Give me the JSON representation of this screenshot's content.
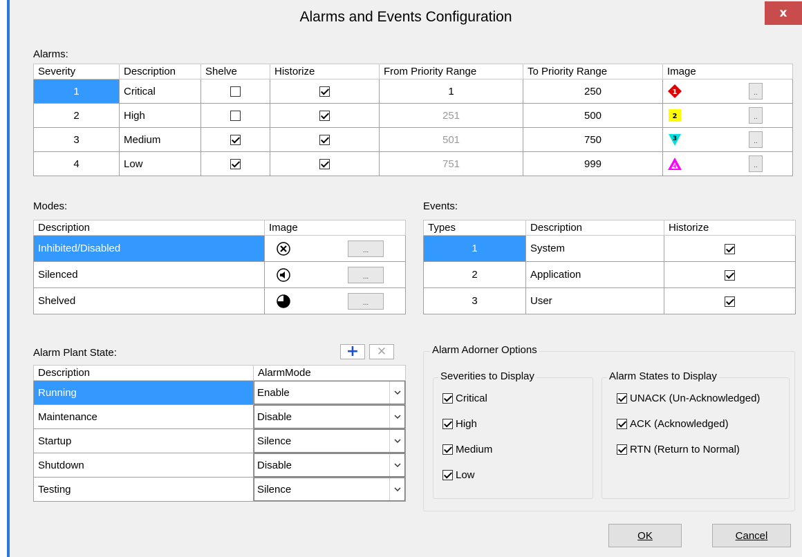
{
  "window": {
    "title": "Alarms and Events Configuration",
    "close_glyph": "x"
  },
  "alarms": {
    "label": "Alarms:",
    "columns": [
      "Severity",
      "Description",
      "Shelve",
      "Historize",
      "From Priority Range",
      "To Priority Range",
      "Image"
    ],
    "rows": [
      {
        "severity": "1",
        "description": "Critical",
        "shelve": false,
        "historize": true,
        "from": "1",
        "to": "250",
        "icon": "red-diamond-icon",
        "icon_text": "1",
        "icon_color": "#e00000"
      },
      {
        "severity": "2",
        "description": "High",
        "shelve": false,
        "historize": true,
        "from": "251",
        "to": "500",
        "icon": "yellow-square-icon",
        "icon_text": "2",
        "icon_color": "#ffff00"
      },
      {
        "severity": "3",
        "description": "Medium",
        "shelve": true,
        "historize": true,
        "from": "501",
        "to": "750",
        "icon": "cyan-triangle-icon",
        "icon_text": "3",
        "icon_color": "#00e0e0"
      },
      {
        "severity": "4",
        "description": "Low",
        "shelve": true,
        "historize": true,
        "from": "751",
        "to": "999",
        "icon": "magenta-triangle-icon",
        "icon_text": "4",
        "icon_color": "#ff00ff"
      }
    ],
    "ellipsis": ".."
  },
  "modes": {
    "label": "Modes:",
    "columns": [
      "Description",
      "Image"
    ],
    "rows": [
      {
        "description": "Inhibited/Disabled",
        "icon": "circle-x-icon"
      },
      {
        "description": "Silenced",
        "icon": "circle-speaker-icon"
      },
      {
        "description": "Shelved",
        "icon": "circle-pie-icon"
      }
    ],
    "ellipsis": "..."
  },
  "events": {
    "label": "Events:",
    "columns": [
      "Types",
      "Description",
      "Historize"
    ],
    "rows": [
      {
        "type": "1",
        "description": "System",
        "historize": true
      },
      {
        "type": "2",
        "description": "Application",
        "historize": true
      },
      {
        "type": "3",
        "description": "User",
        "historize": true
      }
    ]
  },
  "plant_state": {
    "label": "Alarm Plant State:",
    "add_icon": "plus-icon",
    "delete_icon": "delete-x-icon",
    "columns": [
      "Description",
      "AlarmMode"
    ],
    "rows": [
      {
        "description": "Running",
        "mode": "Enable"
      },
      {
        "description": "Maintenance",
        "mode": "Disable"
      },
      {
        "description": "Startup",
        "mode": "Silence"
      },
      {
        "description": "Shutdown",
        "mode": "Disable"
      },
      {
        "description": "Testing",
        "mode": "Silence"
      }
    ]
  },
  "adorner": {
    "title": "Alarm Adorner Options",
    "severities_title": "Severities to Display",
    "severities": [
      {
        "label": "Critical",
        "checked": true
      },
      {
        "label": "High",
        "checked": true
      },
      {
        "label": "Medium",
        "checked": true
      },
      {
        "label": "Low",
        "checked": true
      }
    ],
    "states_title": "Alarm States to Display",
    "states": [
      {
        "label": "UNACK (Un-Acknowledged)",
        "checked": true
      },
      {
        "label": "ACK (Acknowledged)",
        "checked": true
      },
      {
        "label": "RTN (Return to Normal)",
        "checked": true
      }
    ]
  },
  "buttons": {
    "ok_label": "OK",
    "cancel_label": "Cancel"
  },
  "colors": {
    "selection": "#3399ff",
    "window_border": "#2b79d4",
    "close_button": "#c94c4c",
    "dialog_bg": "#f0f0f0"
  }
}
